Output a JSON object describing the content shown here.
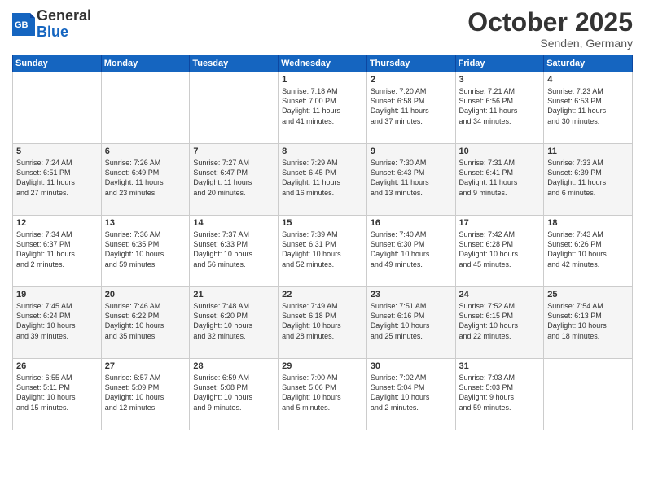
{
  "logo": {
    "general": "General",
    "blue": "Blue"
  },
  "title": "October 2025",
  "subtitle": "Senden, Germany",
  "days_of_week": [
    "Sunday",
    "Monday",
    "Tuesday",
    "Wednesday",
    "Thursday",
    "Friday",
    "Saturday"
  ],
  "weeks": [
    [
      {
        "day": "",
        "info": ""
      },
      {
        "day": "",
        "info": ""
      },
      {
        "day": "",
        "info": ""
      },
      {
        "day": "1",
        "info": "Sunrise: 7:18 AM\nSunset: 7:00 PM\nDaylight: 11 hours\nand 41 minutes."
      },
      {
        "day": "2",
        "info": "Sunrise: 7:20 AM\nSunset: 6:58 PM\nDaylight: 11 hours\nand 37 minutes."
      },
      {
        "day": "3",
        "info": "Sunrise: 7:21 AM\nSunset: 6:56 PM\nDaylight: 11 hours\nand 34 minutes."
      },
      {
        "day": "4",
        "info": "Sunrise: 7:23 AM\nSunset: 6:53 PM\nDaylight: 11 hours\nand 30 minutes."
      }
    ],
    [
      {
        "day": "5",
        "info": "Sunrise: 7:24 AM\nSunset: 6:51 PM\nDaylight: 11 hours\nand 27 minutes."
      },
      {
        "day": "6",
        "info": "Sunrise: 7:26 AM\nSunset: 6:49 PM\nDaylight: 11 hours\nand 23 minutes."
      },
      {
        "day": "7",
        "info": "Sunrise: 7:27 AM\nSunset: 6:47 PM\nDaylight: 11 hours\nand 20 minutes."
      },
      {
        "day": "8",
        "info": "Sunrise: 7:29 AM\nSunset: 6:45 PM\nDaylight: 11 hours\nand 16 minutes."
      },
      {
        "day": "9",
        "info": "Sunrise: 7:30 AM\nSunset: 6:43 PM\nDaylight: 11 hours\nand 13 minutes."
      },
      {
        "day": "10",
        "info": "Sunrise: 7:31 AM\nSunset: 6:41 PM\nDaylight: 11 hours\nand 9 minutes."
      },
      {
        "day": "11",
        "info": "Sunrise: 7:33 AM\nSunset: 6:39 PM\nDaylight: 11 hours\nand 6 minutes."
      }
    ],
    [
      {
        "day": "12",
        "info": "Sunrise: 7:34 AM\nSunset: 6:37 PM\nDaylight: 11 hours\nand 2 minutes."
      },
      {
        "day": "13",
        "info": "Sunrise: 7:36 AM\nSunset: 6:35 PM\nDaylight: 10 hours\nand 59 minutes."
      },
      {
        "day": "14",
        "info": "Sunrise: 7:37 AM\nSunset: 6:33 PM\nDaylight: 10 hours\nand 56 minutes."
      },
      {
        "day": "15",
        "info": "Sunrise: 7:39 AM\nSunset: 6:31 PM\nDaylight: 10 hours\nand 52 minutes."
      },
      {
        "day": "16",
        "info": "Sunrise: 7:40 AM\nSunset: 6:30 PM\nDaylight: 10 hours\nand 49 minutes."
      },
      {
        "day": "17",
        "info": "Sunrise: 7:42 AM\nSunset: 6:28 PM\nDaylight: 10 hours\nand 45 minutes."
      },
      {
        "day": "18",
        "info": "Sunrise: 7:43 AM\nSunset: 6:26 PM\nDaylight: 10 hours\nand 42 minutes."
      }
    ],
    [
      {
        "day": "19",
        "info": "Sunrise: 7:45 AM\nSunset: 6:24 PM\nDaylight: 10 hours\nand 39 minutes."
      },
      {
        "day": "20",
        "info": "Sunrise: 7:46 AM\nSunset: 6:22 PM\nDaylight: 10 hours\nand 35 minutes."
      },
      {
        "day": "21",
        "info": "Sunrise: 7:48 AM\nSunset: 6:20 PM\nDaylight: 10 hours\nand 32 minutes."
      },
      {
        "day": "22",
        "info": "Sunrise: 7:49 AM\nSunset: 6:18 PM\nDaylight: 10 hours\nand 28 minutes."
      },
      {
        "day": "23",
        "info": "Sunrise: 7:51 AM\nSunset: 6:16 PM\nDaylight: 10 hours\nand 25 minutes."
      },
      {
        "day": "24",
        "info": "Sunrise: 7:52 AM\nSunset: 6:15 PM\nDaylight: 10 hours\nand 22 minutes."
      },
      {
        "day": "25",
        "info": "Sunrise: 7:54 AM\nSunset: 6:13 PM\nDaylight: 10 hours\nand 18 minutes."
      }
    ],
    [
      {
        "day": "26",
        "info": "Sunrise: 6:55 AM\nSunset: 5:11 PM\nDaylight: 10 hours\nand 15 minutes."
      },
      {
        "day": "27",
        "info": "Sunrise: 6:57 AM\nSunset: 5:09 PM\nDaylight: 10 hours\nand 12 minutes."
      },
      {
        "day": "28",
        "info": "Sunrise: 6:59 AM\nSunset: 5:08 PM\nDaylight: 10 hours\nand 9 minutes."
      },
      {
        "day": "29",
        "info": "Sunrise: 7:00 AM\nSunset: 5:06 PM\nDaylight: 10 hours\nand 5 minutes."
      },
      {
        "day": "30",
        "info": "Sunrise: 7:02 AM\nSunset: 5:04 PM\nDaylight: 10 hours\nand 2 minutes."
      },
      {
        "day": "31",
        "info": "Sunrise: 7:03 AM\nSunset: 5:03 PM\nDaylight: 9 hours\nand 59 minutes."
      },
      {
        "day": "",
        "info": ""
      }
    ]
  ]
}
